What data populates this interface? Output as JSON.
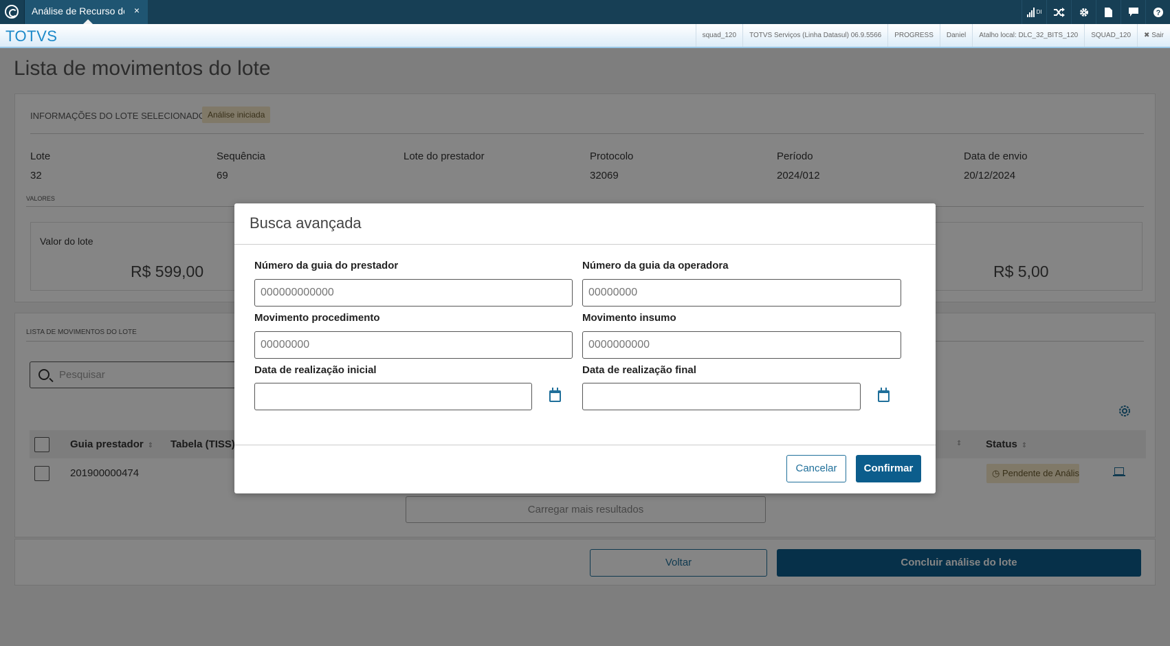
{
  "topbar": {
    "tab_title": "Análise de Recurso de",
    "tab_close": "×",
    "icons": [
      "signal-icon",
      "shuffle-icon",
      "gear-icon",
      "document-icon",
      "chat-icon",
      "help-icon"
    ],
    "signal_label": "DI"
  },
  "infobar": {
    "brand": "TOTVS",
    "items": {
      "environment": "squad_120",
      "product": "TOTVS Serviços (Linha Datasul) 06.9.5566",
      "database": "PROGRESS",
      "user": "Daniel",
      "shortcut": "Atalho local: DLC_32_BITS_120",
      "squad": "SQUAD_120",
      "logout": "✖ Sair"
    }
  },
  "page": {
    "title": "Lista de movimentos do lote"
  },
  "lot_info": {
    "header": "INFORMAÇÕES DO LOTE SELECIONADO",
    "badge": "Análise iniciada",
    "fields": {
      "lote_label": "Lote",
      "lote_value": "32",
      "sequencia_label": "Sequência",
      "sequencia_value": "69",
      "lote_prestador_label": "Lote do prestador",
      "lote_prestador_value": "",
      "protocolo_label": "Protocolo",
      "protocolo_value": "32069",
      "periodo_label": "Período",
      "periodo_value": "2024/012",
      "data_envio_label": "Data de envio",
      "data_envio_value": "20/12/2024"
    },
    "valores_label": "VALORES",
    "valor_lote_label": "Valor do lote",
    "valor_lote_value": "R$ 599,00",
    "right_value": "R$ 5,00"
  },
  "movements": {
    "header": "LISTA DE MOVIMENTOS DO LOTE",
    "search_placeholder": "Pesquisar",
    "columns": {
      "guia_prestador": "Guia prestador",
      "tabela": "Tabela (TISS)",
      "status": "Status"
    },
    "sort_glyph": "⇕",
    "rows": [
      {
        "guia_prestador": "201900000474",
        "status": "Pendente de Análise"
      }
    ],
    "load_more": "Carregar mais resultados"
  },
  "footer": {
    "voltar": "Voltar",
    "concluir": "Concluir análise do lote"
  },
  "modal": {
    "title": "Busca avançada",
    "fields": {
      "guia_prestador_label": "Número da guia do prestador",
      "guia_prestador_placeholder": "000000000000",
      "guia_operadora_label": "Número da guia da operadora",
      "guia_operadora_placeholder": "00000000",
      "mov_procedimento_label": "Movimento procedimento",
      "mov_procedimento_placeholder": "00000000",
      "mov_insumo_label": "Movimento insumo",
      "mov_insumo_placeholder": "0000000000",
      "data_inicial_label": "Data de realização inicial",
      "data_inicial_value": "",
      "data_final_label": "Data de realização final",
      "data_final_value": ""
    },
    "cancel": "Cancelar",
    "confirm": "Confirmar"
  }
}
